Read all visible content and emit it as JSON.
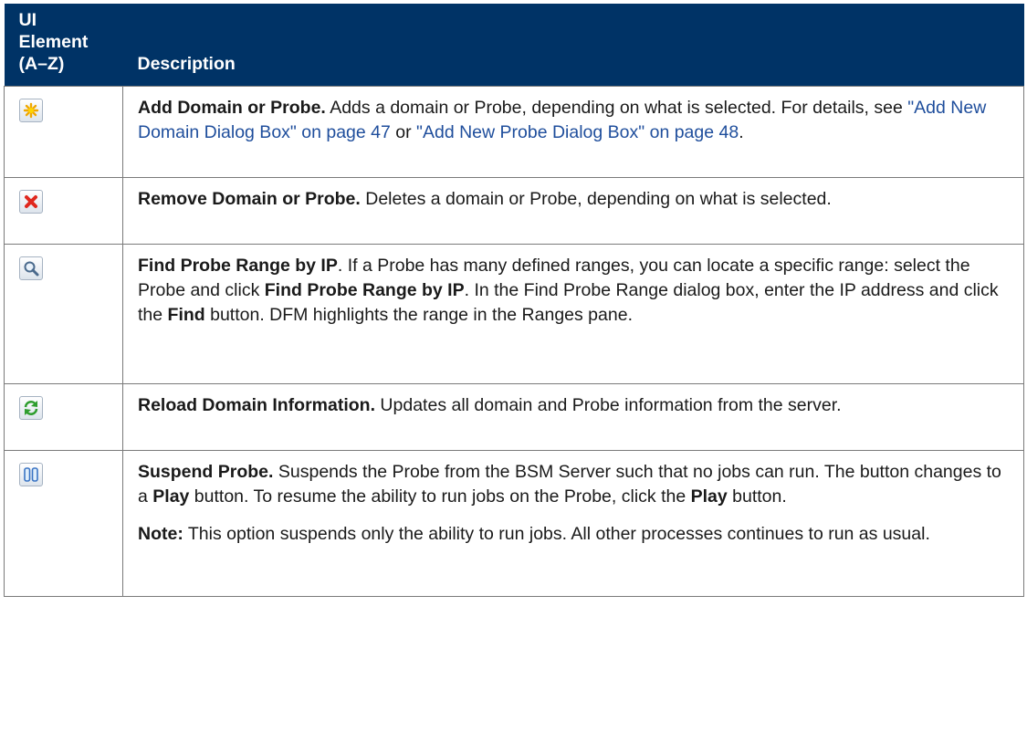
{
  "header": {
    "element_lines": [
      "UI",
      "Element",
      "(A–Z)"
    ],
    "description": "Description"
  },
  "rows": [
    {
      "icon": "add-star-icon",
      "paragraphs": [
        {
          "title": "Add Domain or Probe.",
          "text1": " Adds a domain or Probe, depending on what is selected. For details, see ",
          "link1": "\"Add New Domain Dialog Box\" on page 47",
          "text2": " or ",
          "link2": "\"Add New Probe Dialog Box\" on page 48",
          "text3": "."
        }
      ]
    },
    {
      "icon": "remove-x-icon",
      "paragraphs": [
        {
          "title": "Remove Domain or Probe.",
          "text1": " Deletes a domain or Probe, depending on what is selected."
        }
      ]
    },
    {
      "icon": "magnifier-icon",
      "paragraphs": [
        {
          "title": "Find Probe Range by IP",
          "text1": ". If a Probe has many defined ranges, you can locate a specific range: select the Probe and click ",
          "bold1": "Find Probe Range by IP",
          "text2": ". In the Find Probe Range dialog box, enter the IP address and click the ",
          "bold2": "Find",
          "text3": " button. DFM highlights the range in the Ranges pane."
        }
      ]
    },
    {
      "icon": "reload-icon",
      "paragraphs": [
        {
          "title": "Reload Domain Information.",
          "text1": " Updates all domain and Probe information from the server."
        }
      ]
    },
    {
      "icon": "pause-icon",
      "paragraphs": [
        {
          "title": "Suspend Probe.",
          "text1": " Suspends the Probe from the BSM Server such that no jobs can run. The button changes to a ",
          "bold1": "Play",
          "text2": " button. To resume the ability to run jobs on the Probe, click the ",
          "bold2": "Play",
          "text3": " button."
        },
        {
          "title": "Note:",
          "text1": " This option suspends only the ability to run jobs. All other processes continues to run as usual."
        }
      ]
    }
  ]
}
